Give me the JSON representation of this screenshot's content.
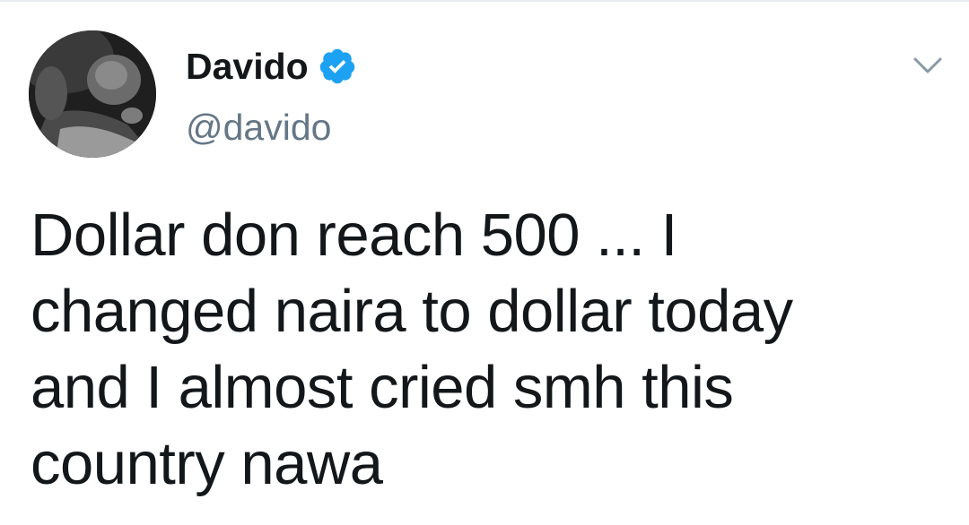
{
  "tweet": {
    "author": {
      "display_name": "Davido",
      "handle": "@davido",
      "verified": true,
      "verified_color": "#1da1f2"
    },
    "text": "Dollar don reach 500 ... I\nchanged naira to dollar today\nand I almost cried smh this\ncountry nawa",
    "text_color": "#14171a",
    "handle_color": "#657786",
    "icons": {
      "avatar": "avatar-photo",
      "verified": "verified-badge-icon",
      "menu": "chevron-down-icon"
    }
  }
}
